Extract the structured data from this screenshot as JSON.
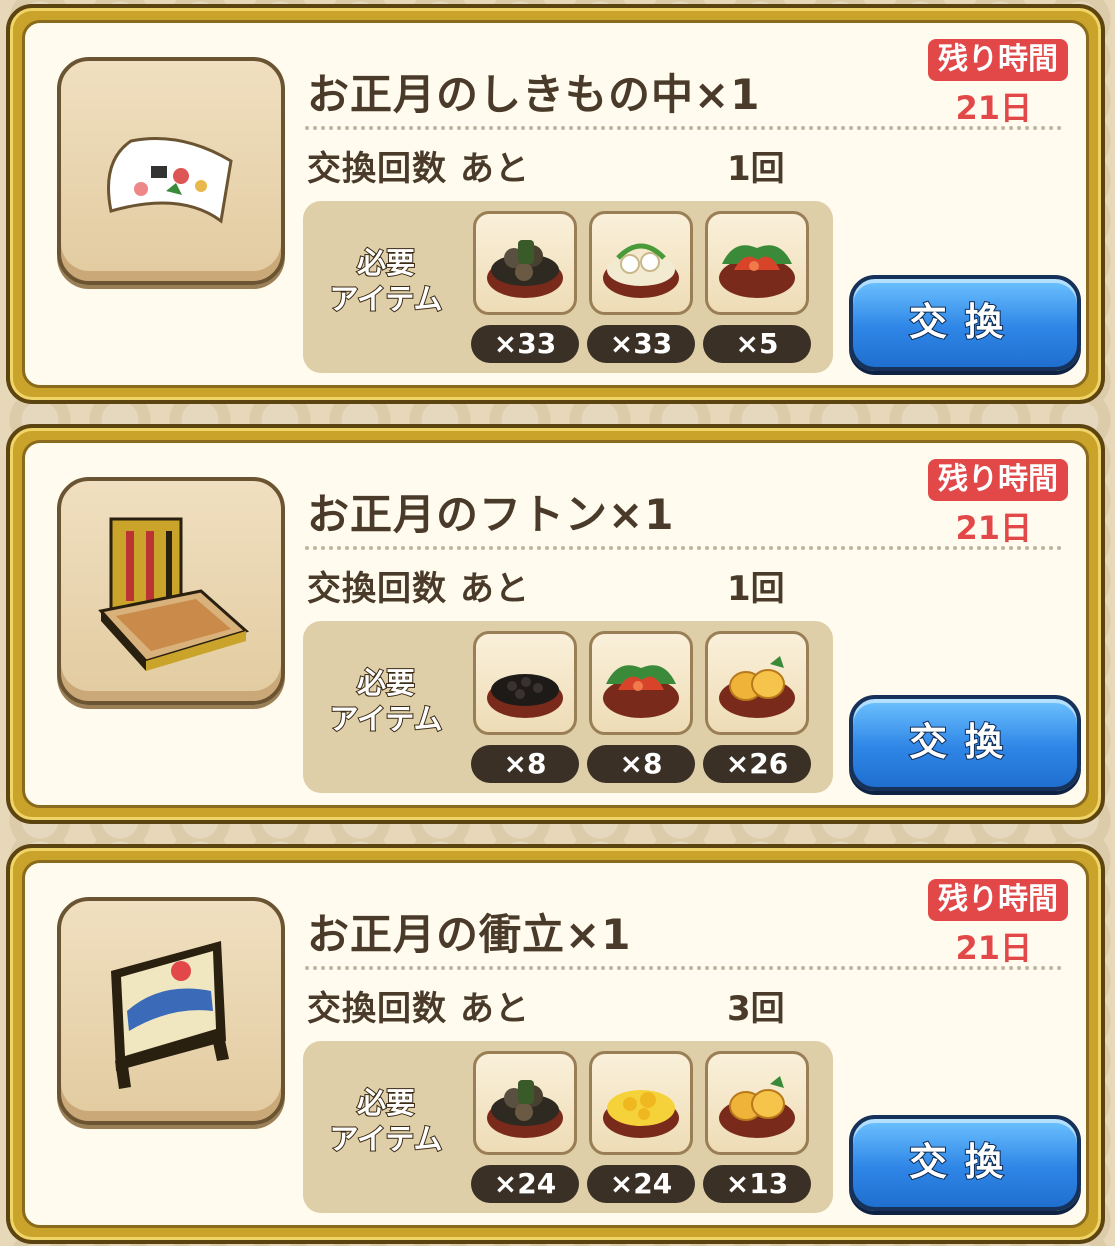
{
  "cards": [
    {
      "title": "お正月のしきもの中×1",
      "timer_label": "残り時間",
      "timer_value": "21日",
      "count_label": "交換回数 あと",
      "count_value": "1回",
      "required_label": "必要\nアイテム",
      "items": [
        {
          "icon": "kuromame-bowl-icon",
          "qty": "×33"
        },
        {
          "icon": "renkon-bowl-icon",
          "qty": "×33"
        },
        {
          "icon": "ebi-bowl-icon",
          "qty": "×5"
        }
      ],
      "button_label": "交換"
    },
    {
      "title": "お正月のフトン×1",
      "timer_label": "残り時間",
      "timer_value": "21日",
      "count_label": "交換回数 あと",
      "count_value": "1回",
      "required_label": "必要\nアイテム",
      "items": [
        {
          "icon": "kuromame-bowl-icon",
          "qty": "×8"
        },
        {
          "icon": "ebi-bowl-icon",
          "qty": "×8"
        },
        {
          "icon": "datemaki-bowl-icon",
          "qty": "×26"
        }
      ],
      "button_label": "交換"
    },
    {
      "title": "お正月の衝立×1",
      "timer_label": "残り時間",
      "timer_value": "21日",
      "count_label": "交換回数 あと",
      "count_value": "3回",
      "required_label": "必要\nアイテム",
      "items": [
        {
          "icon": "kobumaki-bowl-icon",
          "qty": "×24"
        },
        {
          "icon": "kurikinton-bowl-icon",
          "qty": "×24"
        },
        {
          "icon": "datemaki-bowl-icon",
          "qty": "×13"
        }
      ],
      "button_label": "交換"
    }
  ],
  "colors": {
    "timer_red": "#e24848",
    "button_blue": "#2f86e6",
    "card_gold": "#c9a32a"
  }
}
